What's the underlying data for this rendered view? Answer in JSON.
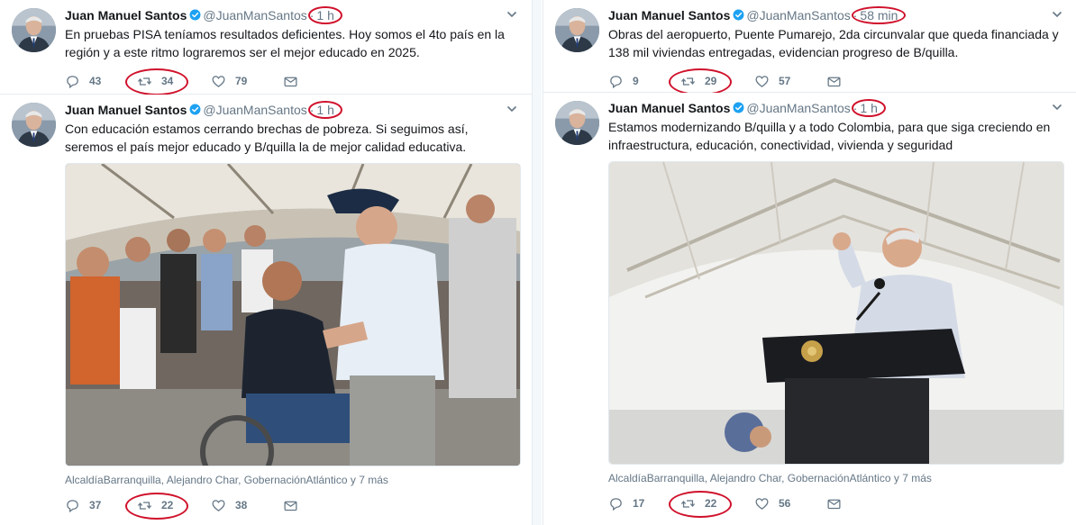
{
  "left": {
    "tweets": [
      {
        "name": "Juan Manuel Santos",
        "handle": "@JuanManSantos",
        "dot": "·",
        "time": "1 h",
        "text": "En pruebas PISA teníamos resultados deficientes. Hoy somos el 4to país en la región y a este ritmo lograremos ser el mejor educado en 2025.",
        "replies": "43",
        "retweets": "34",
        "likes": "79"
      },
      {
        "name": "Juan Manuel Santos",
        "handle": "@JuanManSantos",
        "dot": "·",
        "time": "1 h",
        "text": "Con educación estamos cerrando brechas de pobreza. Si seguimos así, seremos el país mejor educado y B/quilla la de mejor calidad educativa.",
        "tags": "AlcaldíaBarranquilla, Alejandro Char, GobernaciónAtlántico y 7 más",
        "replies": "37",
        "retweets": "22",
        "likes": "38"
      }
    ]
  },
  "right": {
    "tweets": [
      {
        "name": "Juan Manuel Santos",
        "handle": "@JuanManSantos",
        "dot": "·",
        "time": "58 min",
        "text": "Obras del aeropuerto, Puente Pumarejo, 2da circunvalar que queda financiada y 138 mil viviendas entregadas, evidencian progreso de B/quilla.",
        "replies": "9",
        "retweets": "29",
        "likes": "57"
      },
      {
        "name": "Juan Manuel Santos",
        "handle": "@JuanManSantos",
        "dot": "·",
        "time": "1 h",
        "text": "Estamos modernizando B/quilla y a todo Colombia, para que siga creciendo en infraestructura, educación, conectividad, vivienda y seguridad",
        "tags": "AlcaldíaBarranquilla, Alejandro Char, GobernaciónAtlántico y 7 más",
        "replies": "17",
        "retweets": "22",
        "likes": "56"
      }
    ]
  },
  "colors": {
    "accent": "#1da1f2",
    "annotation": "#d0112b",
    "muted": "#657786"
  },
  "icons": [
    "avatar",
    "verified-badge-icon",
    "chevron-down-icon",
    "reply-icon",
    "retweet-icon",
    "like-icon",
    "direct-message-icon"
  ]
}
